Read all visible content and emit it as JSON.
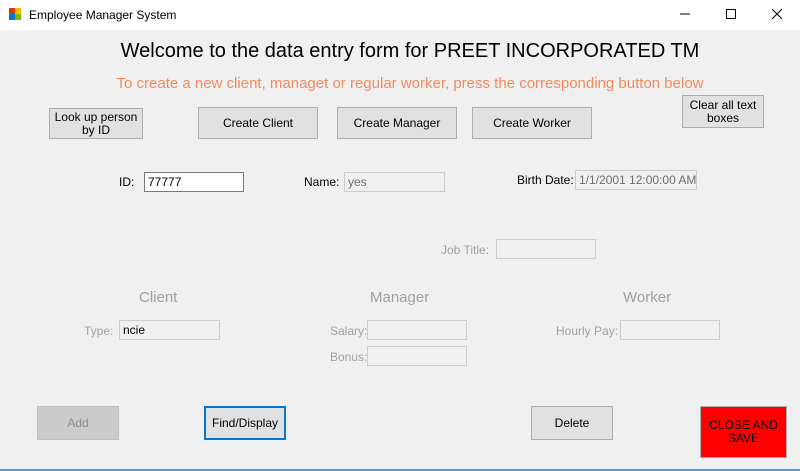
{
  "window": {
    "title": "Employee Manager System",
    "controls": {
      "minimize": "minimize-icon",
      "maximize": "maximize-icon",
      "close": "close-icon"
    }
  },
  "header": {
    "title": "Welcome to the data entry form for PREET INCORPORATED TM",
    "subtitle": "To create a new client, managet or regular worker, press the corresponding button below"
  },
  "toolbar": {
    "lookup_label": "Look up person by ID",
    "create_client_label": "Create Client",
    "create_manager_label": "Create Manager",
    "create_worker_label": "Create Worker",
    "clear_label": "Clear all text boxes"
  },
  "person": {
    "id_label": "ID:",
    "id_value": "77777",
    "name_label": "Name:",
    "name_value": "yes",
    "birth_label": "Birth Date:",
    "birth_value": "1/1/2001 12:00:00 AM",
    "job_title_label": "Job Title:",
    "job_title_value": ""
  },
  "client": {
    "heading": "Client",
    "type_label": "Type:",
    "type_value": "ncie"
  },
  "manager": {
    "heading": "Manager",
    "salary_label": "Salary:",
    "salary_value": "",
    "bonus_label": "Bonus:",
    "bonus_value": ""
  },
  "worker": {
    "heading": "Worker",
    "hourly_label": "Hourly Pay:",
    "hourly_value": ""
  },
  "actions": {
    "add_label": "Add",
    "find_label": "Find/Display",
    "delete_label": "Delete",
    "close_label": "CLOSE AND SAVE"
  },
  "colors": {
    "subtitle": "#f28a5c",
    "close_button": "#ff0000",
    "focus_border": "#0078d7"
  }
}
